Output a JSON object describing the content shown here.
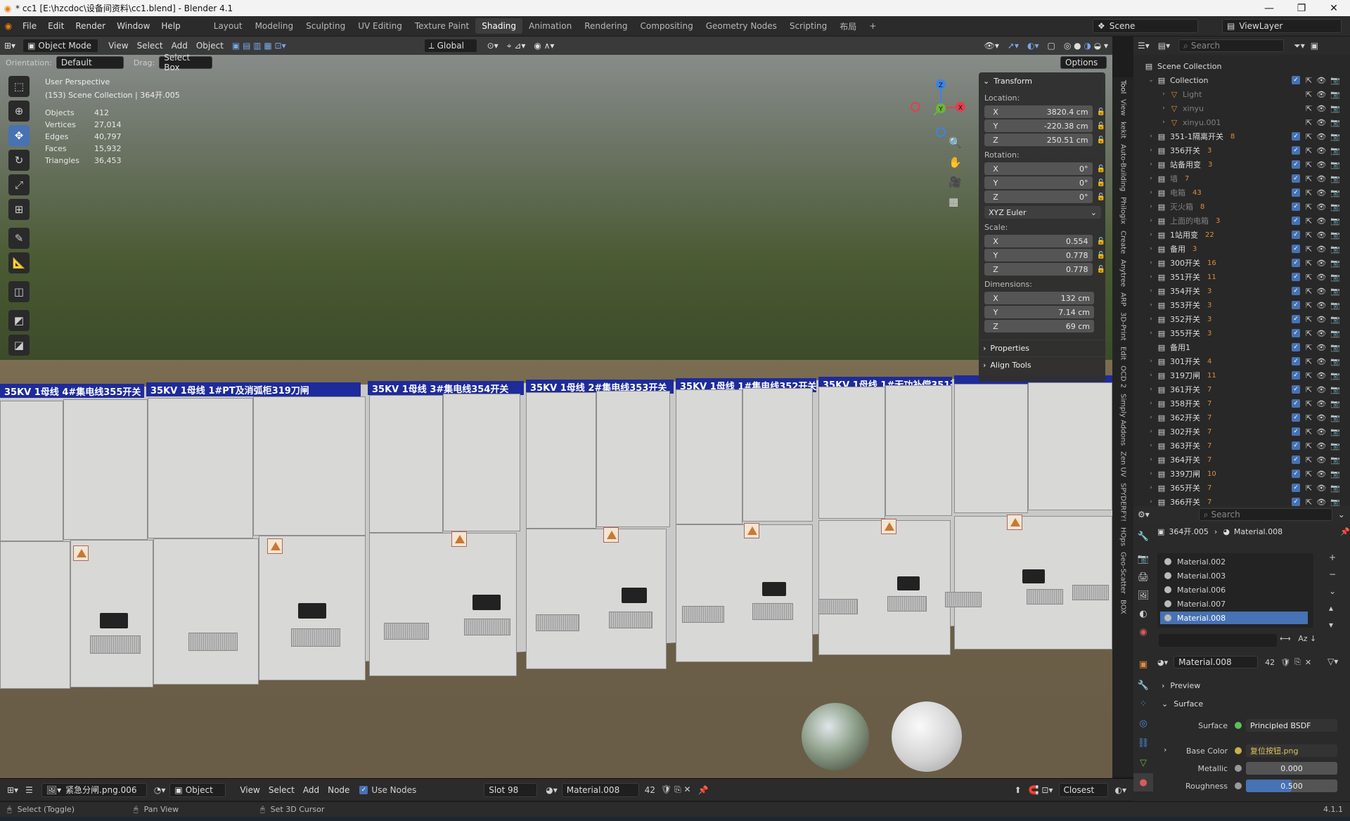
{
  "window": {
    "title": "* cc1 [E:\\hzcdoc\\设备间资料\\cc1.blend] - Blender 4.1",
    "controls": [
      "—",
      "❐",
      "✕"
    ]
  },
  "menus": [
    "File",
    "Edit",
    "Render",
    "Window",
    "Help"
  ],
  "workspaces": [
    "Layout",
    "Modeling",
    "Sculpting",
    "UV Editing",
    "Texture Paint",
    "Shading",
    "Animation",
    "Rendering",
    "Compositing",
    "Geometry Nodes",
    "Scripting",
    "布局",
    "+"
  ],
  "active_workspace": "Shading",
  "scene": {
    "label": "Scene",
    "view_layer": "ViewLayer"
  },
  "viewport_header": {
    "mode": "Object Mode",
    "menus": [
      "View",
      "Select",
      "Add",
      "Object"
    ],
    "transform_orientation": "Global",
    "orientation_label": "Orientation:",
    "orientation_value": "Default",
    "drag_label": "Drag:",
    "drag_value": "Select Box",
    "options": "Options"
  },
  "overlay_text": {
    "view": "User Perspective",
    "collection": "(153) Scene Collection | 364开.005"
  },
  "stats": [
    {
      "k": "Objects",
      "v": "412"
    },
    {
      "k": "Vertices",
      "v": "27,014"
    },
    {
      "k": "Edges",
      "v": "40,797"
    },
    {
      "k": "Faces",
      "v": "15,932"
    },
    {
      "k": "Triangles",
      "v": "36,453"
    }
  ],
  "gizmo": {
    "z": "Z",
    "y": "Y",
    "x": "X"
  },
  "npanel": {
    "transform": "Transform",
    "location_label": "Location:",
    "location": [
      {
        "ax": "X",
        "v": "3820.4 cm"
      },
      {
        "ax": "Y",
        "v": "-220.38 cm"
      },
      {
        "ax": "Z",
        "v": "250.51 cm"
      }
    ],
    "rotation_label": "Rotation:",
    "rotation": [
      {
        "ax": "X",
        "v": "0°"
      },
      {
        "ax": "Y",
        "v": "0°"
      },
      {
        "ax": "Z",
        "v": "0°"
      }
    ],
    "rotation_mode": "XYZ Euler",
    "scale_label": "Scale:",
    "scale": [
      {
        "ax": "X",
        "v": "0.554"
      },
      {
        "ax": "Y",
        "v": "0.778"
      },
      {
        "ax": "Z",
        "v": "0.778"
      }
    ],
    "dimensions_label": "Dimensions:",
    "dimensions": [
      {
        "ax": "X",
        "v": "132 cm"
      },
      {
        "ax": "Y",
        "v": "7.14 cm"
      },
      {
        "ax": "Z",
        "v": "69 cm"
      }
    ],
    "properties": "Properties",
    "align_tools": "Align Tools"
  },
  "sidebar_tabs": [
    "Tool",
    "View",
    "kekit",
    "Auto-Building",
    "Philogix",
    "Create",
    "Anytree",
    "ARP",
    "3D-Print",
    "Edit",
    "OCD 2",
    "Simply Addons",
    "Zen UV",
    "SPYDERFY!",
    "HOps",
    "Geo-Scatter",
    "BOX"
  ],
  "cabinet_signs": [
    "35KV 1母线 4#集电线355开关",
    "35KV 1母线 1#PT及消弧柜319刀闸",
    "35KV 1母线 3#集电线354开关",
    "35KV 1母线 2#集电线353开关",
    "35KV 1母线 1#集电线352开关",
    "35KV 1母线 1#无功补偿351开关"
  ],
  "outliner": {
    "search": "Search",
    "root": "Scene Collection",
    "items": [
      {
        "name": "Collection",
        "depth": 0,
        "meta": ""
      },
      {
        "name": "Light",
        "depth": 1,
        "meta": "",
        "dim": true
      },
      {
        "name": "xinyu",
        "depth": 1,
        "meta": "",
        "dim": true
      },
      {
        "name": "xinyu.001",
        "depth": 1,
        "meta": "",
        "dim": true
      },
      {
        "name": "351-1隔离开关",
        "depth": 0,
        "meta": "8"
      },
      {
        "name": "356开关",
        "depth": 0,
        "meta": "3"
      },
      {
        "name": "站备用变",
        "depth": 0,
        "meta": "3"
      },
      {
        "name": "墙",
        "depth": 0,
        "meta": "7",
        "dim": true
      },
      {
        "name": "电箱",
        "depth": 0,
        "meta": "43",
        "dim": true
      },
      {
        "name": "灭火箱",
        "depth": 0,
        "meta": "8",
        "dim": true
      },
      {
        "name": "上面的电箱",
        "depth": 0,
        "meta": "3",
        "dim": true
      },
      {
        "name": "1站用变",
        "depth": 0,
        "meta": "22"
      },
      {
        "name": "备用",
        "depth": 0,
        "meta": "3"
      },
      {
        "name": "300开关",
        "depth": 0,
        "meta": "16"
      },
      {
        "name": "351开关",
        "depth": 0,
        "meta": "11"
      },
      {
        "name": "354开关",
        "depth": 0,
        "meta": "3"
      },
      {
        "name": "353开关",
        "depth": 0,
        "meta": "3"
      },
      {
        "name": "352开关",
        "depth": 0,
        "meta": "3"
      },
      {
        "name": "355开关",
        "depth": 0,
        "meta": "3"
      },
      {
        "name": "备用1",
        "depth": 0,
        "meta": ""
      },
      {
        "name": "301开关",
        "depth": 0,
        "meta": "4"
      },
      {
        "name": "319刀闸",
        "depth": 0,
        "meta": "11"
      },
      {
        "name": "361开关",
        "depth": 0,
        "meta": "7"
      },
      {
        "name": "358开关",
        "depth": 0,
        "meta": "7"
      },
      {
        "name": "362开关",
        "depth": 0,
        "meta": "7"
      },
      {
        "name": "302开关",
        "depth": 0,
        "meta": "7"
      },
      {
        "name": "363开关",
        "depth": 0,
        "meta": "7"
      },
      {
        "name": "364开关",
        "depth": 0,
        "meta": "7"
      },
      {
        "name": "339刀闸",
        "depth": 0,
        "meta": "10"
      },
      {
        "name": "365开关",
        "depth": 0,
        "meta": "7"
      },
      {
        "name": "366开关",
        "depth": 0,
        "meta": "7"
      }
    ]
  },
  "properties": {
    "search": "Search",
    "breadcrumb_object": "364开.005",
    "breadcrumb_material": "Material.008",
    "slots": [
      "Material.002",
      "Material.003",
      "Material.006",
      "Material.007",
      "Material.008"
    ],
    "selected_slot": "Material.008",
    "material_name": "Material.008",
    "users": "42",
    "preview": "Preview",
    "surface_section": "Surface",
    "surface_label": "Surface",
    "surface_value": "Principled BSDF",
    "base_color_label": "Base Color",
    "base_color_value": "复位按钮.png",
    "metallic_label": "Metallic",
    "metallic_value": "0.000",
    "roughness_label": "Roughness",
    "roughness_value": "0.500",
    "roughness_fraction": 0.5
  },
  "node_header": {
    "image": "紧急分闸.png.006",
    "object": "Object",
    "menus": [
      "View",
      "Select",
      "Add",
      "Node"
    ],
    "use_nodes": "Use Nodes",
    "slot": "Slot 98",
    "material": "Material.008",
    "users": "42",
    "snap": "Closest"
  },
  "statusbar": {
    "select": "Select (Toggle)",
    "pan": "Pan View",
    "cursor": "Set 3D Cursor",
    "version": "4.1.1"
  },
  "colors": {
    "accent": "#4772b3",
    "orange": "#e87d0d",
    "sign_blue": "#1e2b9a"
  }
}
